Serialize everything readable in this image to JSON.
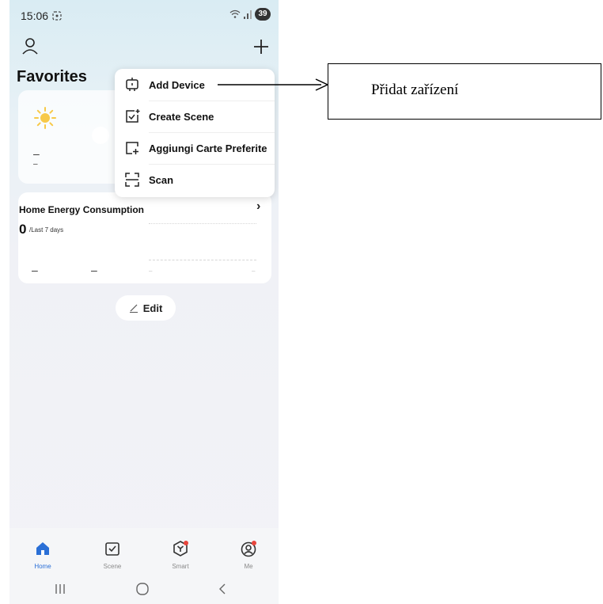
{
  "status": {
    "time": "15:06",
    "battery": "39"
  },
  "home": {
    "title": "Favorites",
    "edit_label": "Edit"
  },
  "weather": {
    "dash1": "–",
    "dash2": "–"
  },
  "energy": {
    "title": "Home Energy Consumption",
    "value": "0",
    "period": "/Last 7 days",
    "dash": "–"
  },
  "menu": {
    "items": [
      {
        "label": "Add Device",
        "icon": "add-device-icon"
      },
      {
        "label": "Create Scene",
        "icon": "create-scene-icon"
      },
      {
        "label": "Aggiungi Carte Preferite",
        "icon": "add-card-icon"
      },
      {
        "label": "Scan",
        "icon": "scan-icon"
      }
    ]
  },
  "tabs": [
    {
      "label": "Home",
      "icon": "home-icon",
      "active": true
    },
    {
      "label": "Scene",
      "icon": "scene-icon",
      "active": false
    },
    {
      "label": "Smart",
      "icon": "smart-icon",
      "active": false
    },
    {
      "label": "Me",
      "icon": "profile-icon",
      "active": false
    }
  ],
  "annotation": {
    "text": "Přidat zařízení"
  },
  "colors": {
    "accent": "#2a6fd6",
    "badge": "#e8453c",
    "sun": "#f7c948"
  }
}
